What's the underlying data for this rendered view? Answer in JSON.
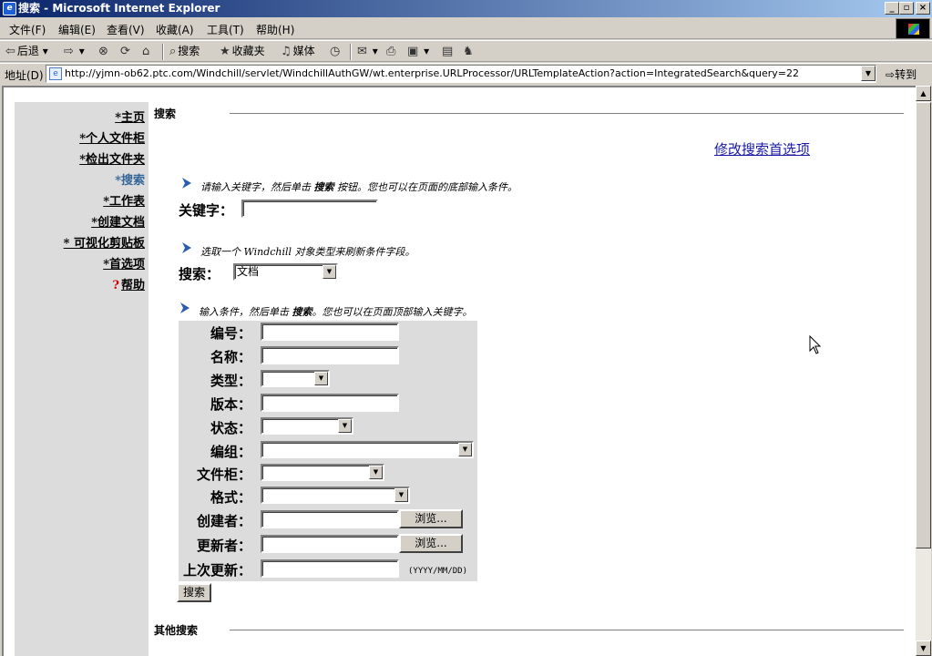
{
  "window": {
    "title": "搜索 - Microsoft Internet Explorer",
    "app_icon_text": "e"
  },
  "menu": [
    "文件(F)",
    "编辑(E)",
    "查看(V)",
    "收藏(A)",
    "工具(T)",
    "帮助(H)"
  ],
  "toolbar": {
    "back": "后退",
    "search": "搜索",
    "favorites": "收藏夹",
    "media": "媒体"
  },
  "address": {
    "label": "地址(D)",
    "url": "http://yjmn-ob62.ptc.com/Windchill/servlet/WindchillAuthGW/wt.enterprise.URLProcessor/URLTemplateAction?action=IntegratedSearch&query=22",
    "go": "转到"
  },
  "sidebar": {
    "items": [
      {
        "label": "*主页"
      },
      {
        "label": "*个人文件柜"
      },
      {
        "label": "*检出文件夹"
      },
      {
        "label": "*搜索"
      },
      {
        "label": "*工作表"
      },
      {
        "label": "*创建文档"
      },
      {
        "label": "* 可视化剪贴板"
      },
      {
        "label": "*首选项"
      },
      {
        "label": "帮助",
        "icon": "?"
      }
    ]
  },
  "main": {
    "section_title": "搜索",
    "prefs_link": "修改搜索首选项",
    "hint1_a": "请输入关键字，然后单击 ",
    "hint1_b": "搜索",
    "hint1_c": " 按钮。您也可以在页面的底部输入条件。",
    "keyword_label": "关键字：",
    "hint2": "选取一个 Windchill 对象类型来刷新条件字段。",
    "search_label": "搜索：",
    "search_type_value": "文档",
    "hint3_a": "输入条件，然后单击 ",
    "hint3_b": "搜索",
    "hint3_c": "。您也可以在页面顶部输入关键字。",
    "fields": {
      "number": "编号：",
      "name": "名称：",
      "type": "类型：",
      "version": "版本：",
      "state": "状态：",
      "team": "编组：",
      "cabinet": "文件柜：",
      "format": "格式：",
      "creator": "创建者：",
      "modifier": "更新者：",
      "last_updated": "上次更新："
    },
    "browse_label": "浏览...",
    "date_format": "(YYYY/MM/DD)",
    "search_button": "搜索",
    "other_search_title": "其他搜索"
  },
  "colors": {
    "title_start": "#0a246a",
    "title_end": "#a6caf0",
    "sidebar_bg": "#dcdcdc",
    "active_link": "#336699",
    "link": "#1a1aa6"
  }
}
